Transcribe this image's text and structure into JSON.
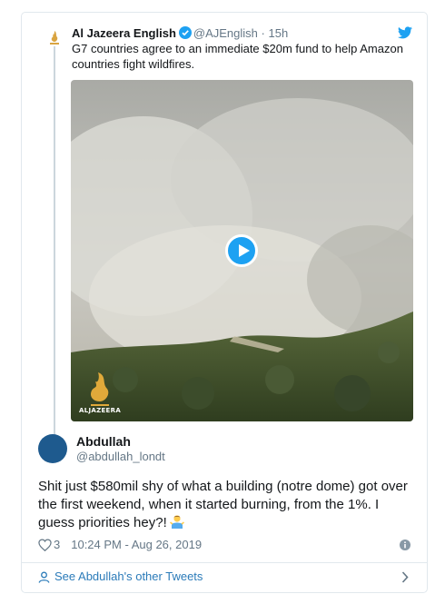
{
  "parent_tweet": {
    "name": "Al Jazeera English",
    "handle": "@AJEnglish",
    "separator": "·",
    "time": "15h",
    "text": "G7 countries agree to an immediate $20m fund to help Amazon countries fight wildfires.",
    "media_watermark": "ALJAZEERA"
  },
  "tweet": {
    "name": "Abdullah",
    "handle": "@abdullah_londt",
    "text": "Shit just $580mil shy of what a building (notre dome) got over the first weekend, when it started burning, from the 1%. I guess priorities hey?!",
    "likes": "3",
    "timestamp": "10:24 PM - Aug 26, 2019"
  },
  "footer": {
    "more_tweets": "See Abdullah's other Tweets"
  },
  "icons": {
    "source_logo": "al-jazeera-logo-icon",
    "verified": "verified-badge-icon",
    "platform": "twitter-bird-icon",
    "play": "play-icon",
    "like": "heart-icon",
    "info": "info-icon",
    "profile": "person-icon",
    "more": "chevron-right-icon",
    "emoji": "man-shrugging-emoji-icon"
  },
  "colors": {
    "accent": "#1da1f2",
    "link": "#2b7bb9",
    "text": "#14171a",
    "muted": "#657786",
    "border": "#e1e8ed"
  }
}
